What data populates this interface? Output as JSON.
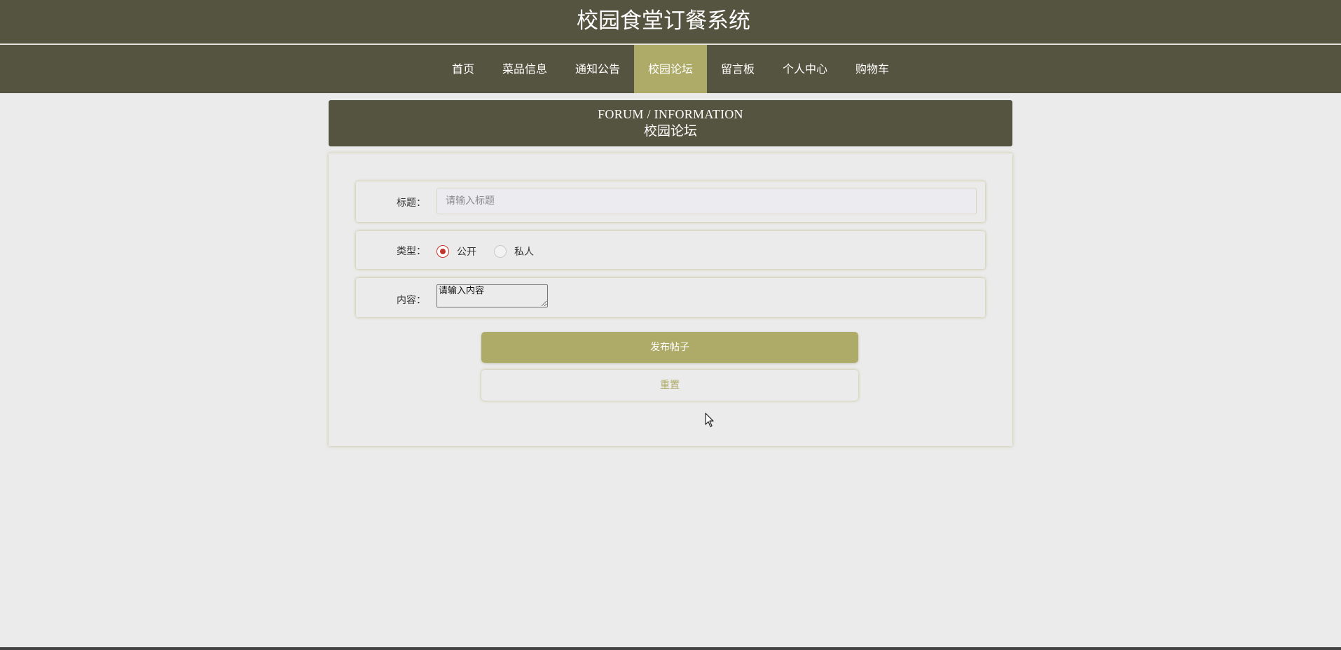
{
  "header": {
    "site_title": "校园食堂订餐系统"
  },
  "nav": {
    "items": [
      {
        "label": "首页"
      },
      {
        "label": "菜品信息"
      },
      {
        "label": "通知公告"
      },
      {
        "label": "校园论坛",
        "active": true
      },
      {
        "label": "留言板"
      },
      {
        "label": "个人中心"
      },
      {
        "label": "购物车"
      }
    ]
  },
  "section": {
    "title_en": "FORUM / INFORMATION",
    "title_zh": "校园论坛"
  },
  "form": {
    "title_label": "标题：",
    "title_placeholder": "请输入标题",
    "title_value": "",
    "type_label": "类型：",
    "type_options": [
      {
        "label": "公开",
        "checked": true
      },
      {
        "label": "私人",
        "checked": false
      }
    ],
    "content_label": "内容：",
    "content_placeholder": "请输入内容",
    "submit_label": "发布帖子",
    "reset_label": "重置"
  },
  "colors": {
    "header_bg": "#555440",
    "accent": "#aeab69",
    "page_bg": "#ebebeb",
    "radio_checked": "#c4342d"
  },
  "icons": {
    "cursor": "mouse-pointer-icon"
  }
}
